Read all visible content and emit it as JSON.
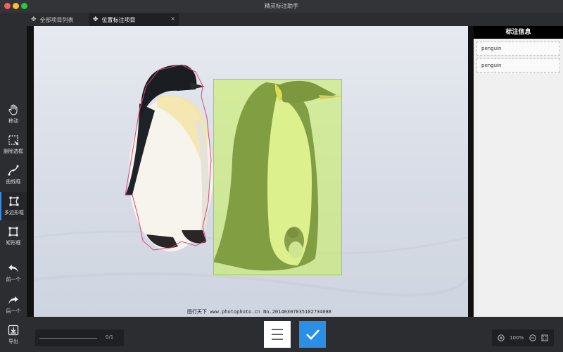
{
  "window": {
    "title": "精灵标注助手"
  },
  "tabs": [
    {
      "label": "全部项目列表",
      "icon": "gear-icon"
    },
    {
      "label": "位置标注项目",
      "icon": "gear-icon",
      "active": true,
      "close": "×"
    }
  ],
  "toolbar": {
    "items": [
      {
        "label": "移动",
        "icon": "hand-icon"
      },
      {
        "label": "删除选框",
        "icon": "delete-box-icon"
      },
      {
        "label": "曲线框",
        "icon": "curve-icon"
      },
      {
        "label": "多边形框",
        "icon": "polygon-icon",
        "active": true
      },
      {
        "label": "矩形框",
        "icon": "rectangle-icon"
      },
      {
        "label": "前一个",
        "icon": "undo-arrow-icon"
      },
      {
        "label": "后一个",
        "icon": "redo-arrow-icon"
      },
      {
        "label": "导出",
        "icon": "export-icon"
      }
    ]
  },
  "canvas": {
    "image_credit": "图行天下 www.photophoto.cn No.20140307035102734088",
    "annotations": [
      {
        "type": "polygon",
        "label": "penguin",
        "color": "#e0457b"
      },
      {
        "type": "rectangle",
        "label": "penguin",
        "color": "#b6e05c"
      }
    ]
  },
  "info_panel": {
    "title": "标注信息",
    "items": [
      "penguin",
      "penguin"
    ]
  },
  "bottom": {
    "progress_text": "0/1",
    "progress_value": 0,
    "zoom_text": "100%",
    "accent_color": "#2b8fe6"
  }
}
